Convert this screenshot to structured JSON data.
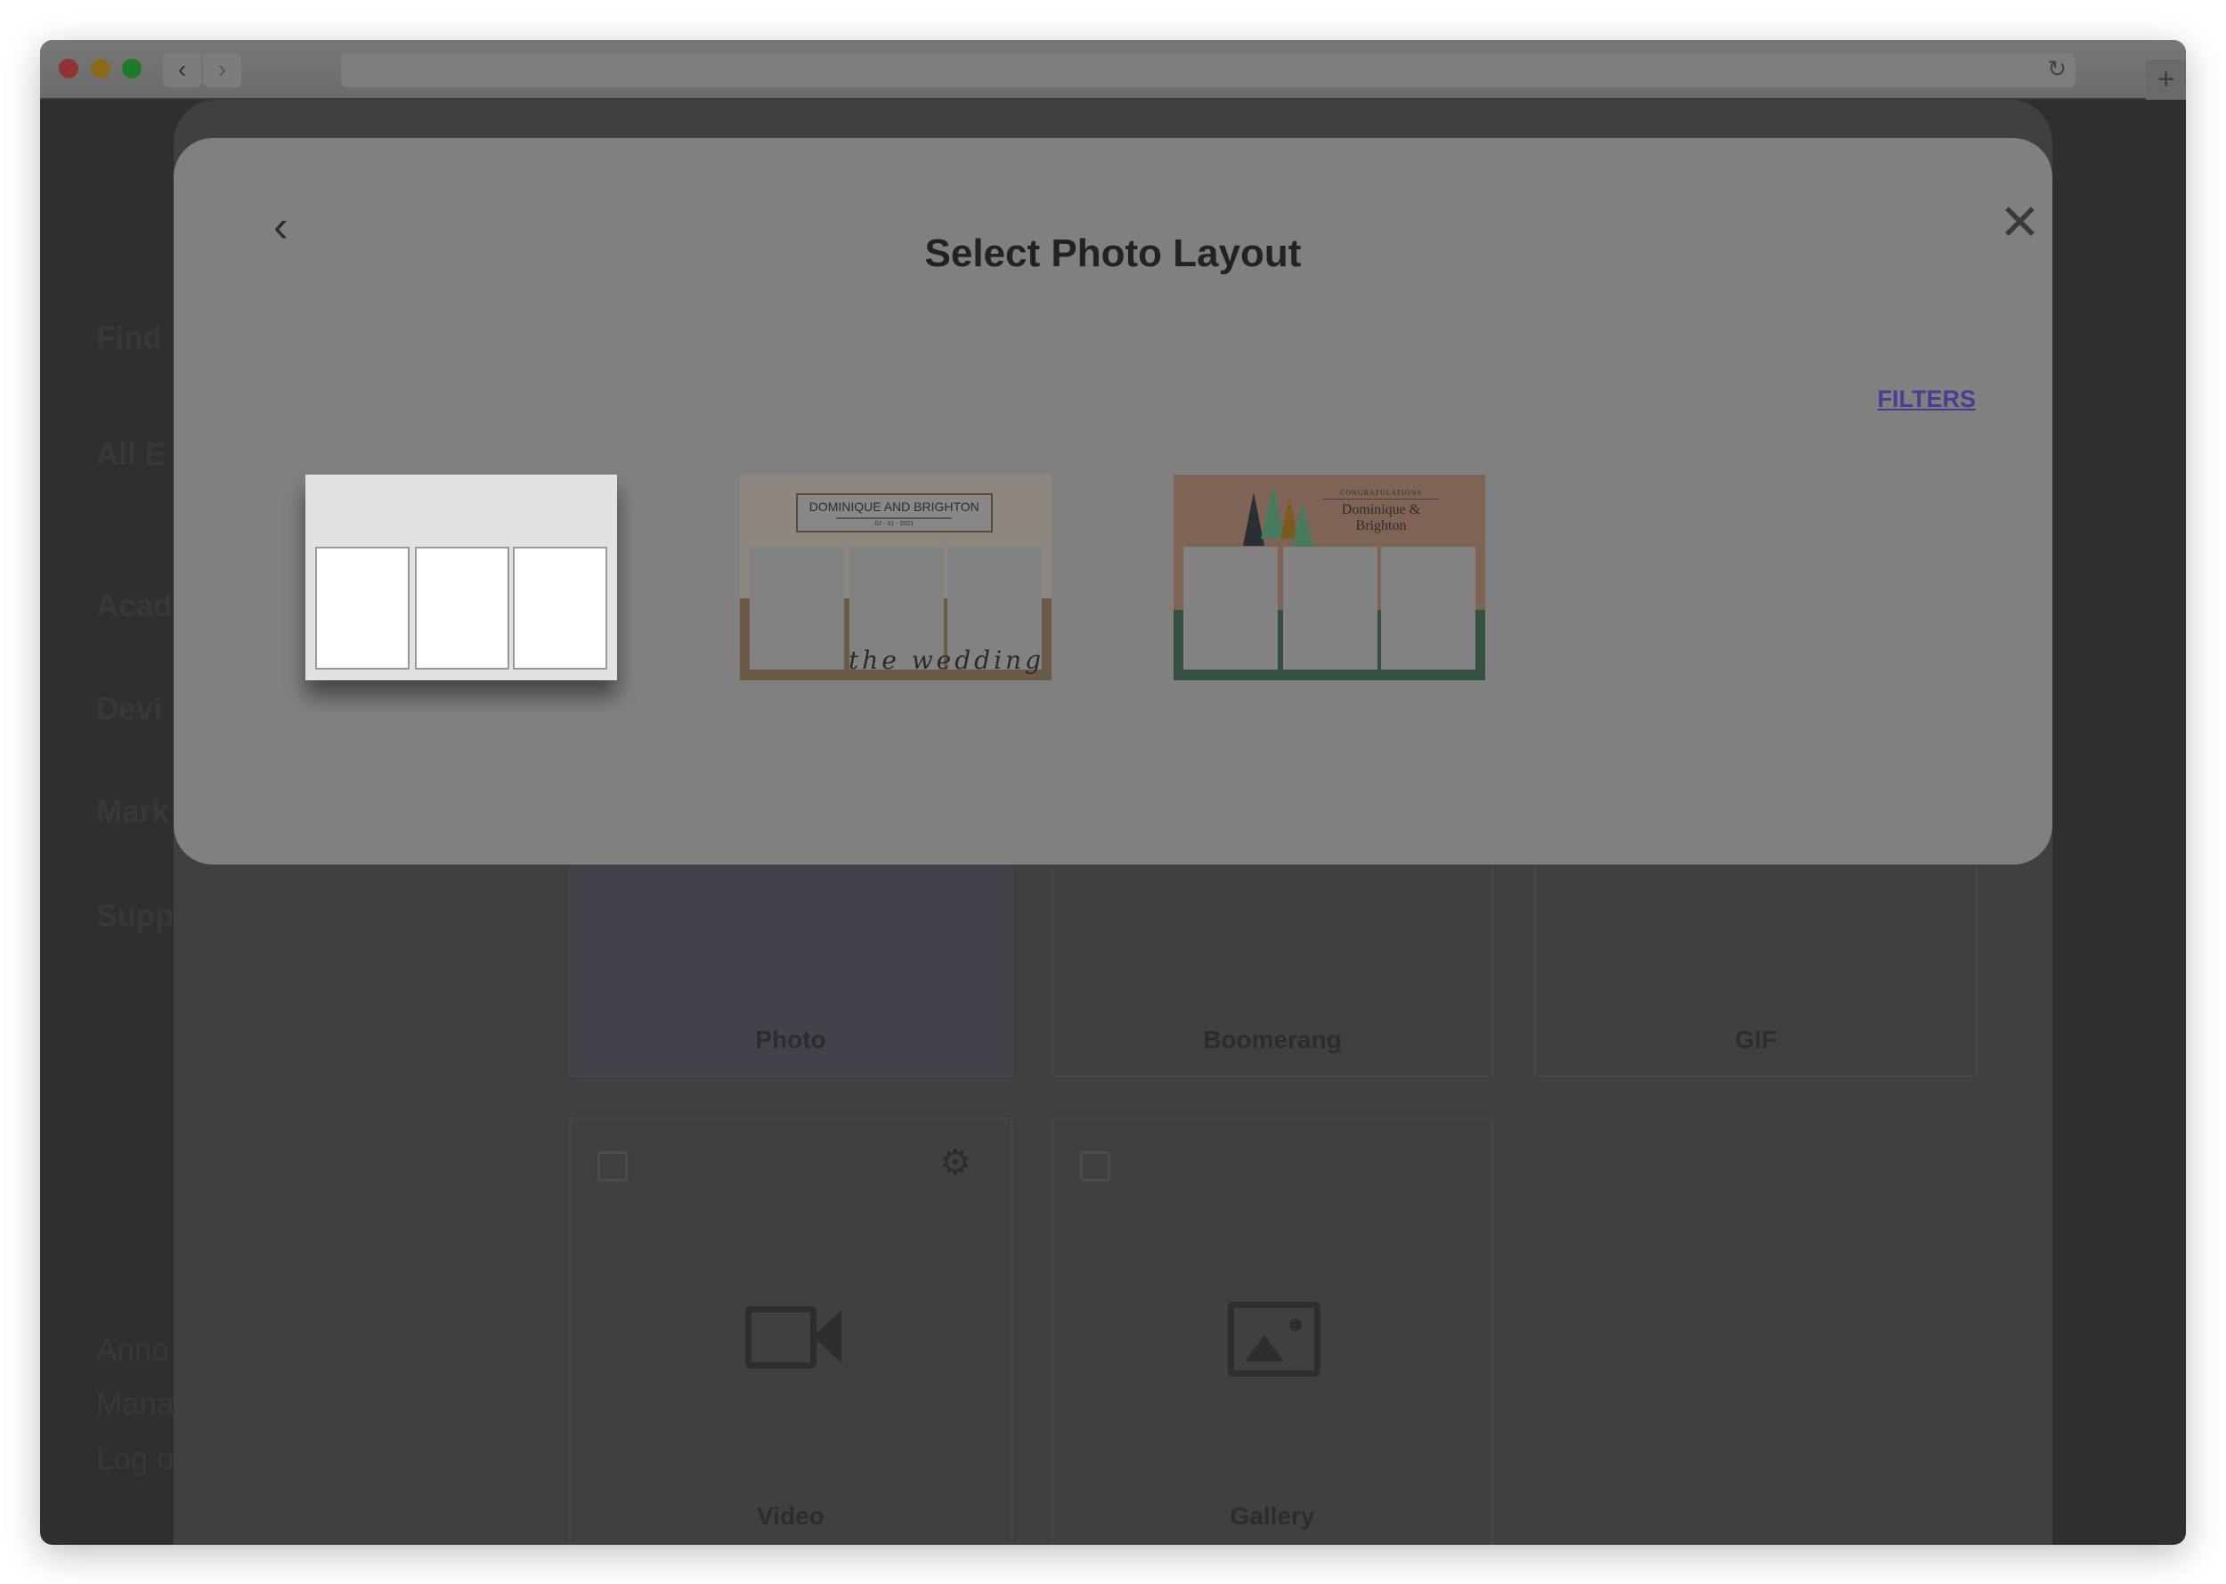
{
  "browser": {
    "back_icon": "chevron-left-icon",
    "forward_icon": "chevron-right-icon",
    "reload_icon": "reload-icon",
    "new_tab_icon": "plus-icon"
  },
  "sidebar": {
    "items": [
      "Find",
      "All E",
      "Acad",
      "Devi",
      "Mark",
      "Supp",
      "Anno",
      "Mana",
      "Log o"
    ]
  },
  "background": {
    "cards": [
      {
        "label": "Photo"
      },
      {
        "label": "Boomerang"
      },
      {
        "label": "GIF"
      },
      {
        "label": "Video"
      },
      {
        "label": "Gallery"
      }
    ]
  },
  "modal": {
    "title": "Select Photo Layout",
    "filters_label": "FILTERS",
    "accent_color": "#4d3a93",
    "layouts": [
      {
        "name": "blank-three-strip",
        "selected": true
      },
      {
        "name": "wedding",
        "heading": "DOMINIQUE AND BRIGHTON",
        "date": "02 - 01 - 2021",
        "script": "the wedding"
      },
      {
        "name": "congratulations",
        "kicker": "CONGRATULATIONS",
        "names_line1": "Dominique &",
        "names_line2": "Brighton"
      }
    ]
  }
}
